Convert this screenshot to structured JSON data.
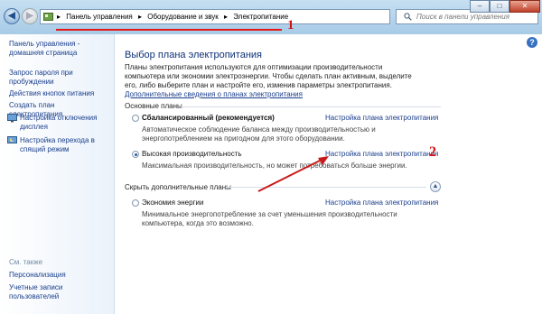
{
  "address": {
    "crumbs": [
      "Панель управления",
      "Оборудование и звук",
      "Электропитание"
    ],
    "marker": "1"
  },
  "search": {
    "placeholder": "Поиск в панели управления"
  },
  "window_buttons": {
    "minimize": "–",
    "maximize": "□",
    "close": "✕"
  },
  "left_pane": {
    "links": [
      "Панель управления - домашняя страница",
      "Запрос пароля при пробуждении",
      "Действия кнопок питания",
      "Создать план электропитания"
    ],
    "icon_links": [
      "Настройка отключения дисплея",
      "Настройка перехода в спящий режим"
    ],
    "see_also": {
      "title": "См. также",
      "links": [
        "Персонализация",
        "Учетные записи пользователей"
      ]
    }
  },
  "main": {
    "title": "Выбор плана электропитания",
    "intro_text": "Планы электропитания используются для оптимизации производительности компьютера или экономии электроэнергии. Чтобы сделать план активным, выделите его, либо выберите план и настройте его, изменив параметры электропитания.",
    "intro_link": "Дополнительные сведения о планах электропитания",
    "main_group_label": "Основные планы",
    "extra_group_label": "Скрыть дополнительные планы",
    "plan_link_label": "Настройка плана электропитания",
    "plans": [
      {
        "name": "Сбалансированный (рекомендуется)",
        "desc": "Автоматическое соблюдение баланса между производительностью и энергопотреблением на пригодном для этого оборудовании.",
        "selected": false
      },
      {
        "name": "Высокая производительность",
        "desc": "Максимальная производительность, но может потребоваться больше энергии.",
        "selected": true
      },
      {
        "name": "Экономия энергии",
        "desc": "Минимальное энергопотребление за счет уменьшения производительности компьютера, когда это возможно.",
        "selected": false
      }
    ],
    "marker": "2"
  },
  "colors": {
    "annotation": "#d31212",
    "link": "#1a3e8c"
  }
}
